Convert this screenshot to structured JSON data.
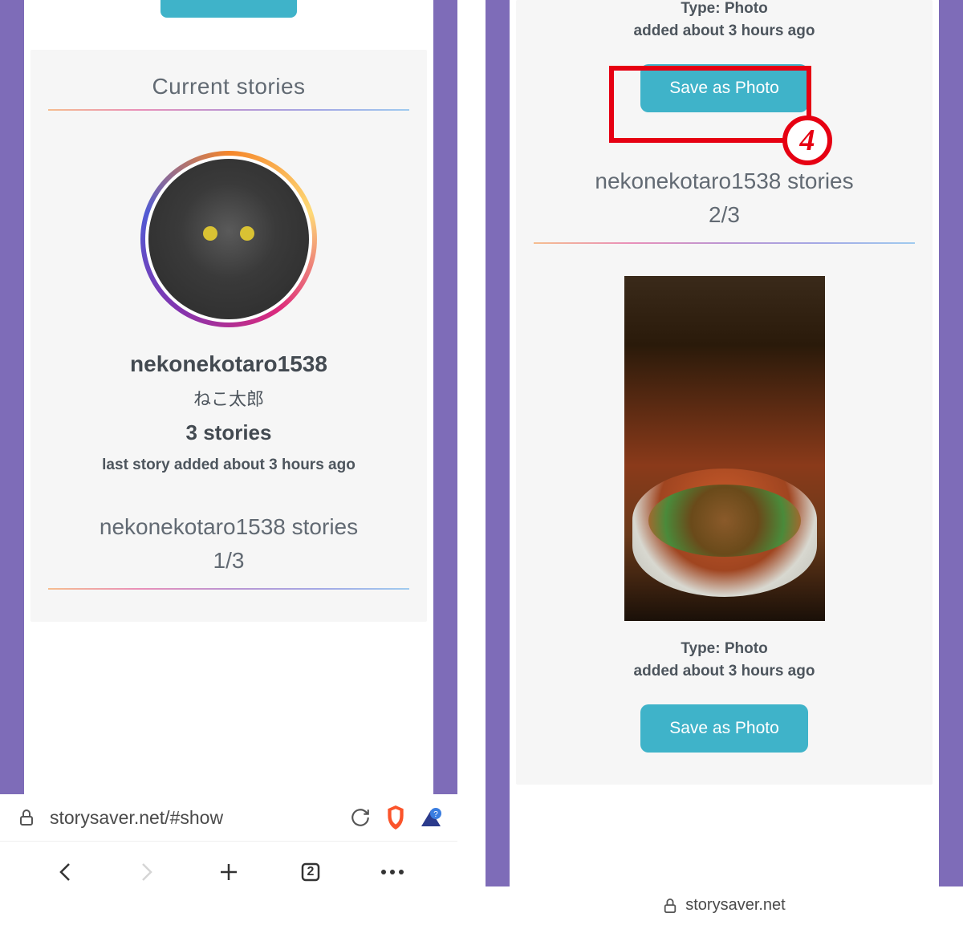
{
  "annotation": {
    "step_number": "4"
  },
  "left": {
    "section_title": "Current stories",
    "profile": {
      "username": "nekonekotaro1538",
      "display_name": "ねこ太郎",
      "story_count_text": "3 stories",
      "last_story_text": "last story added about 3 hours ago"
    },
    "stories_heading": "nekonekotaro1538 stories",
    "stories_counter": "1/3",
    "browser": {
      "url": "storysaver.net/#show",
      "tab_count": "2"
    }
  },
  "right": {
    "story1": {
      "type_label": "Type: Photo",
      "added_text": "added about 3 hours ago",
      "save_button": "Save as Photo"
    },
    "stories_heading": "nekonekotaro1538 stories",
    "stories_counter": "2/3",
    "story2": {
      "type_label": "Type: Photo",
      "added_text": "added about 3 hours ago",
      "save_button": "Save as Photo"
    },
    "browser": {
      "url": "storysaver.net"
    }
  }
}
